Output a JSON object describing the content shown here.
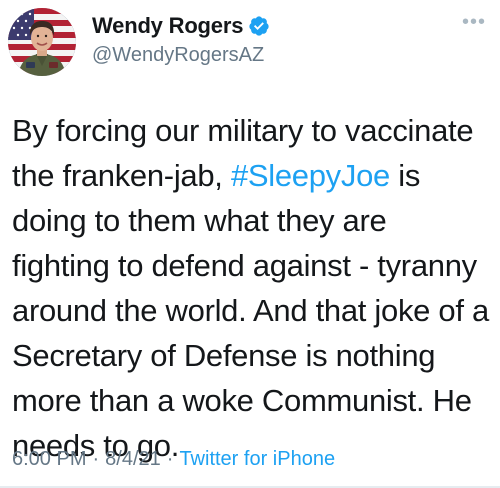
{
  "author": {
    "display_name": "Wendy Rogers",
    "handle": "@WendyRogersAZ",
    "verified": true,
    "verified_icon": "verified-badge-icon",
    "avatar_icon": "profile-photo"
  },
  "more_icon": "ellipsis-icon",
  "tweet": {
    "text_before": "By forcing our military to vaccinate the franken-jab, ",
    "hashtag": "#SleepyJoe",
    "text_after": " is doing to them what they are fighting to defend against - tyranny around the world. And that joke of a Secretary of Defense is nothing more than a woke Communist. He needs to go."
  },
  "meta": {
    "time": "6:00 PM",
    "sep1": "·",
    "date": "8/4/21",
    "sep2": "·",
    "source": "Twitter for iPhone"
  },
  "colors": {
    "link": "#1da1f2",
    "secondary_text": "#657786",
    "primary_text": "#14171a"
  }
}
